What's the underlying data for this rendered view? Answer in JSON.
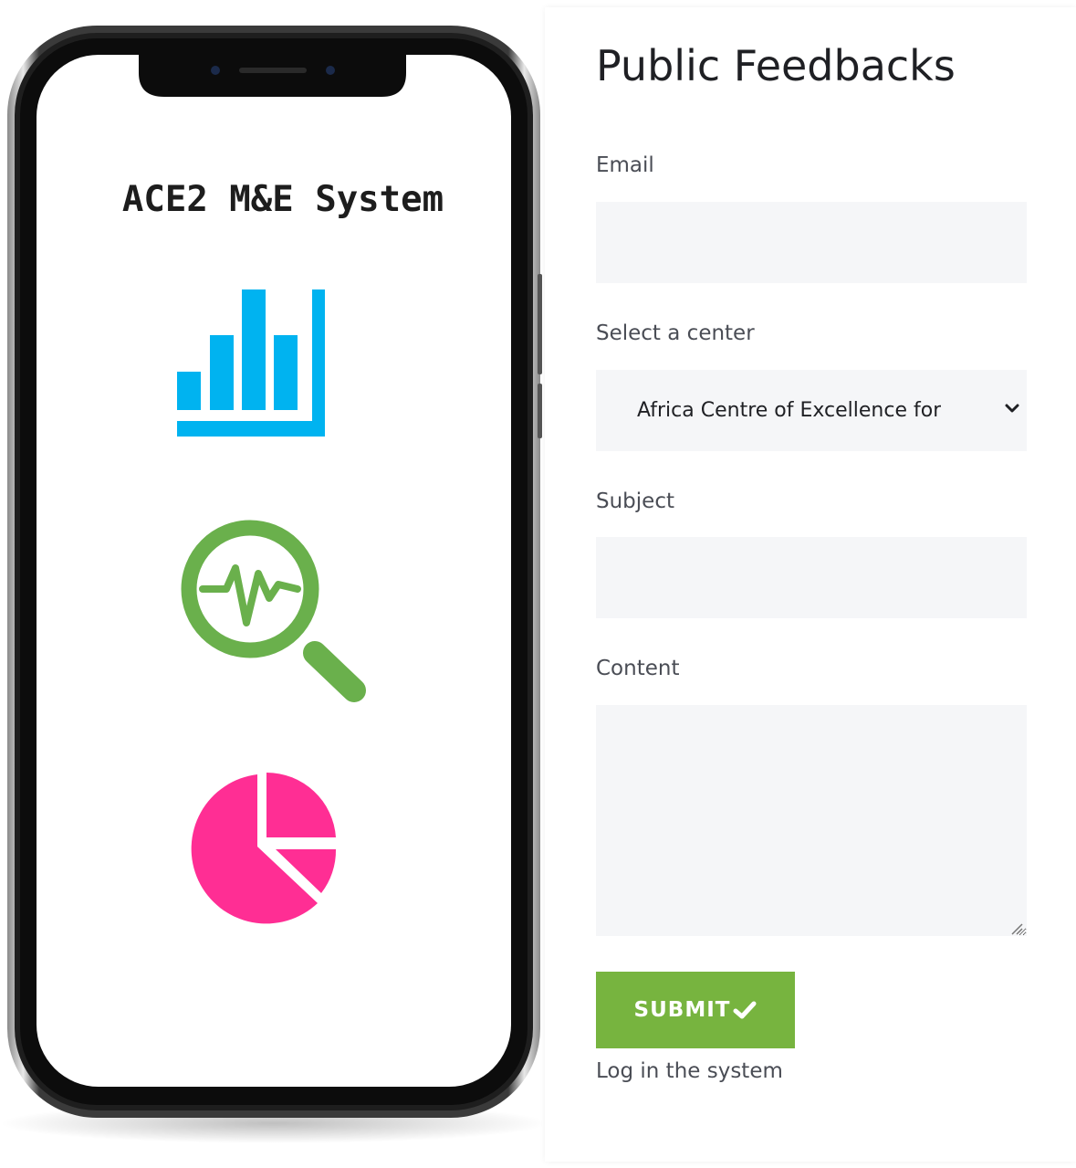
{
  "phone": {
    "screen_title": "ACE2 M&E System",
    "icons": [
      "bar-chart-icon",
      "magnifier-pulse-icon",
      "pie-chart-icon"
    ],
    "colors": {
      "bar_chart": "#00b3f0",
      "magnifier": "#6ab04c",
      "pie_chart": "#ff2e94"
    }
  },
  "form": {
    "title": "Public Feedbacks",
    "email": {
      "label": "Email",
      "value": ""
    },
    "center": {
      "label": "Select a center",
      "selected": "Africa Centre of Excellence for"
    },
    "subject": {
      "label": "Subject",
      "value": ""
    },
    "content": {
      "label": "Content",
      "value": ""
    },
    "submit_label": "SUBMIT",
    "login_link": "Log in the system",
    "colors": {
      "submit": "#77b43f",
      "field_bg": "#f5f6f8"
    }
  }
}
